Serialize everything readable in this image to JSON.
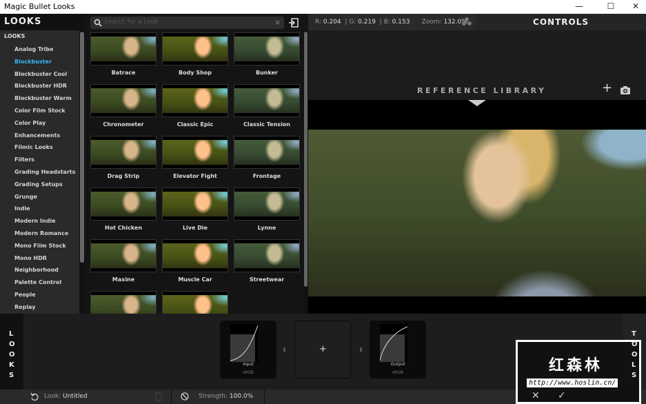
{
  "window": {
    "title": "Magic Bullet Looks",
    "minimize": "—",
    "maximize": "☐",
    "close": "✕"
  },
  "sidebar": {
    "header": "LOOKS",
    "section": "LOOKS",
    "selected": "Blockbuster",
    "items": [
      "Analog Tribe",
      "Blockbuster",
      "Blockbuster Cool",
      "Blockbuster HDR",
      "Blockbuster Warm",
      "Color Film Stock",
      "Color Play",
      "Enhancements",
      "Filmic Looks",
      "Filters",
      "Grading Headstarts",
      "Grading Setups",
      "Grunge",
      "Indie",
      "Modern Indie",
      "Modern Romance",
      "Mono Film Stock",
      "Mono HDR",
      "Neighborhood",
      "Palette Control",
      "People",
      "Replay"
    ]
  },
  "search": {
    "placeholder": "Search for a Look",
    "icon": "search-icon",
    "clear": "×"
  },
  "looks": [
    "Batrace",
    "Body Shop",
    "Bunker",
    "Chronometer",
    "Classic Epic",
    "Classic Tension",
    "Drag Strip",
    "Elevator Fight",
    "Frontage",
    "Hot Chicken",
    "Live Die",
    "Lynne",
    "Maxine",
    "Muscle Car",
    "Streetwear"
  ],
  "info": {
    "r_label": "R:",
    "r": "0.204",
    "g_label": "G:",
    "g": "0.219",
    "b_label": "B:",
    "b": "0.153",
    "zoom_label": "Zoom:",
    "zoom": "132.0%"
  },
  "controls": {
    "title": "CONTROLS"
  },
  "reference_library": {
    "label": "REFERENCE LIBRARY",
    "add": "+"
  },
  "bottom": {
    "looks_tab": "LOOKS",
    "tools_tab": "TOOLS",
    "input_label": "Input",
    "input_space": "sRGB",
    "add": "+",
    "output_label": "Output",
    "output_space": "sRGB"
  },
  "status": {
    "look_label": "Look:",
    "look": "Untitled",
    "strength_label": "Strength:",
    "strength": "100.0%"
  },
  "watermark": {
    "text": "红森林",
    "url": "http://www.hoslin.cn/",
    "cancel": "✕",
    "ok": "✓"
  }
}
